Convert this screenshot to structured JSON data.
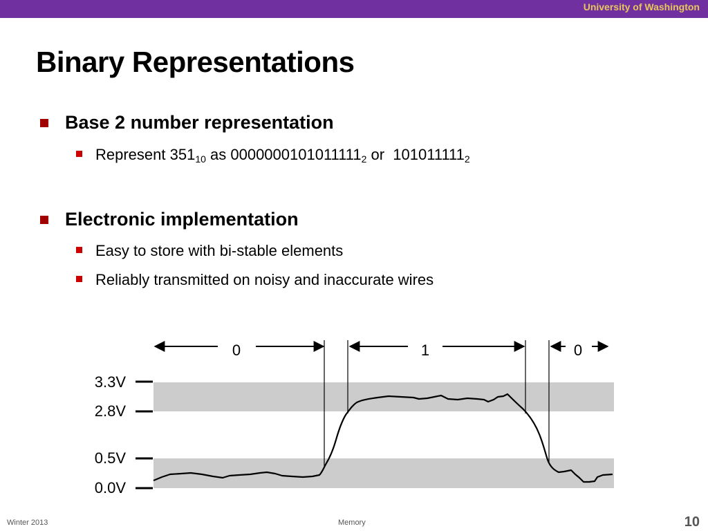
{
  "header": {
    "institution": "University of Washington"
  },
  "title": "Binary Representations",
  "bullets": [
    {
      "heading": "Base 2 number representation",
      "sub": [
        {
          "prefix": "Represent 351",
          "base_a": "10",
          "as_word": " as 0000000101011111",
          "base_b": "2",
          "or_word": " or  101011111",
          "base_c": "2"
        }
      ]
    },
    {
      "heading": "Electronic implementation",
      "sub": [
        {
          "text": "Easy to store with bi-stable elements"
        },
        {
          "text": "Reliably transmitted on noisy and inaccurate wires"
        }
      ]
    }
  ],
  "diagram": {
    "bit_labels": [
      "0",
      "1",
      "0"
    ],
    "voltage_labels": [
      "3.3V",
      "2.8V",
      "0.5V",
      "0.0V"
    ],
    "band_color": "#cccccc"
  },
  "footer": {
    "left": "Winter 2013",
    "center": "Memory",
    "page": "10"
  },
  "colors": {
    "header_bar": "#7030a0",
    "header_text": "#e7c65a",
    "bullet_l1": "#a00000",
    "bullet_l2": "#cc0000"
  }
}
